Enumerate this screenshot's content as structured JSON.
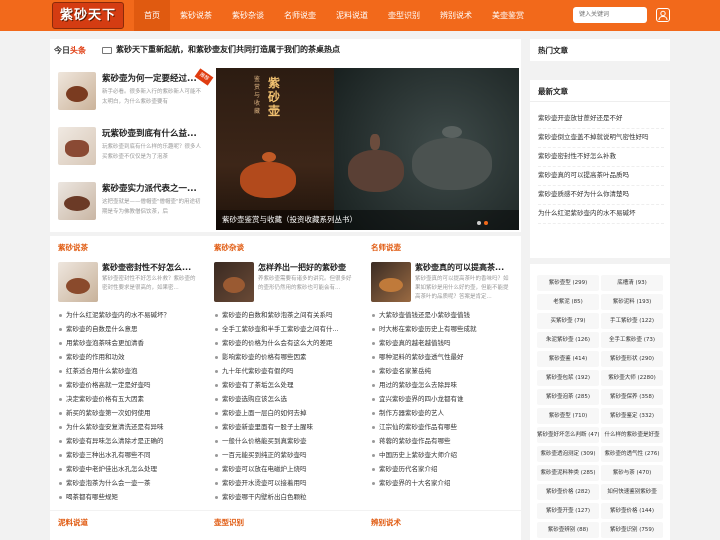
{
  "logo": {
    "text": "紫砂天下"
  },
  "nav": [
    "首页",
    "紫砂说茶",
    "紫砂杂谈",
    "名师说壶",
    "泥料说道",
    "壶型识别",
    "辨别说术",
    "美壶鉴赏"
  ],
  "search": {
    "placeholder": "键入关键词"
  },
  "today": {
    "logo_a": "今日",
    "logo_b": "头条",
    "headline": "紫砂天下重新起航，和紫砂壶友们共同打造属于我们的茶桌热点"
  },
  "featured": [
    {
      "title": "紫砂壶为何一定要经过...",
      "desc": "新手必看。很多新入行的紫砂新人可能不太明白，为什么紫砂壶要有",
      "ribbon": "推荐"
    },
    {
      "title": "玩紫砂壶到底有什么益...",
      "desc": "玩紫砂壶到底有什么样的乐趣呢？很多人买紫砂壶不仅仅是为了泡茶"
    },
    {
      "title": "紫砂壶实力派代表之一...",
      "desc": "这把壶就是——僧帽壶\"僧帽壶\"的用途初期是专为佛教僧侣饮茶，后"
    }
  ],
  "slide": {
    "caption": "紫砂壶鉴赏与收藏（投资收藏系列丛书）",
    "book_title": "紫砂壶",
    "book_sub": "鉴赏与收藏"
  },
  "columns": [
    {
      "title": "紫砂说茶",
      "lead_title": "紫砂壶密封性不好怎么...",
      "lead_desc": "紫砂壶密封性不好怎么补救？紫砂壶的密封性要求是很高的，如果密...",
      "items": [
        "为什么红泥紫砂壶内的水不易碱坏？",
        "紫砂壶的自数是什么意思",
        "用紫砂壶泡茶味会更加清香",
        "紫砂壶的作用和功效",
        "红茶适合用什么紫砂壶泡",
        "紫砂壶价格高就一定是好壶吗",
        "决定紫砂壶价格有五大因素",
        "新买的紫砂壶第一次如何使用",
        "为什么紫砂壶安复清洗还是有异味",
        "紫砂壶有异味怎么清除才是正确的",
        "紫砂壶三种出水孔有哪些不同",
        "紫砂壶中老炉佳出水孔怎么处理",
        "紫砂壶泡茶为什么会一壶一茶",
        "喝茶都有哪些规矩"
      ]
    },
    {
      "title": "紫砂杂谈",
      "lead_title": "怎样养出一把好的紫砂壶",
      "lead_desc": "养紫砂壶需要有诸多的讲究。但很多好的壶形仍然用的紫砂也可能会有...",
      "items": [
        "紫砂壶的自数和紫砂泡茶之间有关系吗",
        "全手工紫砂壶和半手工紫砂壶之间有什...",
        "紫砂壶的价格为什么会有这么大的差距",
        "影响紫砂壶的价格有哪些因素",
        "九十年代紫砂壶有假的吗",
        "紫砂壶有了茶垢怎么处理",
        "紫砂壶选购应该怎么选",
        "紫砂壶上面一层白的如何去掉",
        "紫砂壶新壶里面有一股子土腥味",
        "一般什么价格能买到真紫砂壶",
        "一百元能买到纯正的紫砂壶吗",
        "紫砂壶可以放在电磁炉上烧吗",
        "紫砂壶开水烫壶可以接着用吗",
        "紫砂壶哪干内壁析出白色颗粒"
      ]
    },
    {
      "title": "名师说壶",
      "lead_title": "紫砂壶真的可以提高茶...",
      "lead_desc": "紫砂壶真的可以提高茶叶的香味吗？如果如紫砂是用什么好的壶，但能不能提高茶叶的品质呢？答案是肯定...",
      "items": [
        "大紫砂壶值钱还是小紫砂壶值钱",
        "时大彬在紫砂壶历史上有哪些成就",
        "紫砂壶真的越老越值钱吗",
        "哪种泥料的紫砂壶透气性最好",
        "紫砂壶名家篆岳纯",
        "用过的紫砂壶怎么去除异味",
        "宜兴紫砂壶界的四小龙都有谁",
        "制作方器紫砂壶的艺人",
        "江宗仙的紫砂壶作品有哪些",
        "蒋蓉的紫砂壶作品有哪些",
        "中国历史上紫砂壶大师介绍",
        "紫砂壶历代名家介绍",
        "紫砂壶界的十大名家介绍"
      ]
    }
  ],
  "bottom_titles": [
    "泥料说道",
    "壶型识别",
    "辨别说术"
  ],
  "hot": {
    "title": "热门文章"
  },
  "latest": {
    "title": "最新文章",
    "items": [
      "紫砂壶开壶放甘蔗好还是不好",
      "紫砂壶倒立壶盖不掉就说明气密性好吗",
      "紫砂壶密封性不好怎么补救",
      "紫砂壶真的可以提高茶叶品质吗",
      "紫砂壶质感不好为什么你清楚吗",
      "为什么红泥紫砂壶内的水不易碱坏"
    ]
  },
  "tags": [
    "紫砂壶型 (299)",
    "底槽清 (93)",
    "老紫泥 (85)",
    "紫砂泥料 (193)",
    "买紫砂壶 (79)",
    "手工紫砂壶 (122)",
    "朱泥紫砂壶 (126)",
    "全手工紫砂壶 (73)",
    "紫砂壶鉴 (414)",
    "紫砂壶形状 (290)",
    "紫砂壶包浆 (192)",
    "紫砂壶大师 (2280)",
    "紫砂壶泡茶 (285)",
    "紫砂壶保养 (358)",
    "紫砂壶型 (710)",
    "紫砂壶鉴定 (332)",
    "紫砂壶好坏怎么判断 (47)",
    "什么样的紫砂壶是好壶",
    "紫砂壶透泡测定 (309)",
    "紫砂壶的透气性 (276)",
    "紫砂壶泥料种类 (285)",
    "紫砂与茶 (470)",
    "紫砂壶价格 (282)",
    "如何快速鉴别紫砂壶",
    "紫砂壶开壶 (127)",
    "紫砂壶价格 (144)",
    "紫砂壶辨别 (88)",
    "紫砂壶识别 (759)"
  ]
}
